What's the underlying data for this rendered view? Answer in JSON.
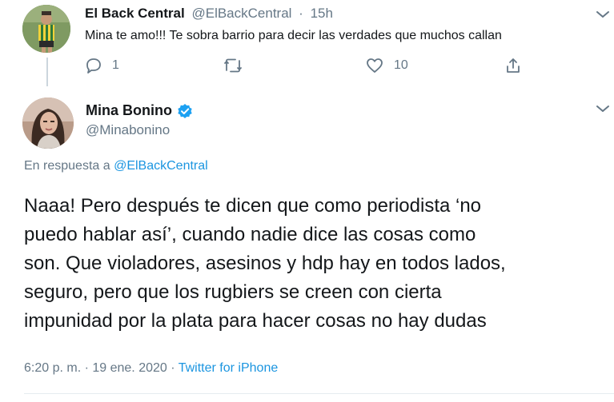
{
  "reply_tweet": {
    "display_name": "El Back Central",
    "handle": "@ElBackCentral",
    "separator": "·",
    "time": "15h",
    "text": "Mina te amo!!! Te sobra barrio para decir las verdades que muchos callan",
    "actions": {
      "reply_count": "1",
      "retweet_count": "",
      "like_count": "10"
    },
    "icons": [
      "reply-icon",
      "retweet-icon",
      "like-icon",
      "share-icon",
      "chevron-down-icon"
    ]
  },
  "main_tweet": {
    "display_name": "Mina Bonino",
    "handle": "@Minabonino",
    "verified": true,
    "in_reply_prefix": "En respuesta a ",
    "in_reply_mention": "@ElBackCentral",
    "text_lines": [
      "Naaa! Pero después te dicen que como periodista ‘no",
      "puedo hablar así’, cuando nadie dice las cosas como",
      "son. Que violadores, asesinos y hdp hay en todos lados,",
      "seguro, pero que los rugbiers se creen con cierta",
      "impunidad por la plata para hacer cosas no hay dudas"
    ],
    "timestamp": "6:20 p. m. · 19 ene. 2020",
    "footer_separator": " · ",
    "source": "Twitter for iPhone"
  },
  "colors": {
    "text": "#14171a",
    "secondary": "#657786",
    "link": "#1b95e0",
    "verified": "#1da1f2",
    "divider": "#e6ecf0"
  }
}
